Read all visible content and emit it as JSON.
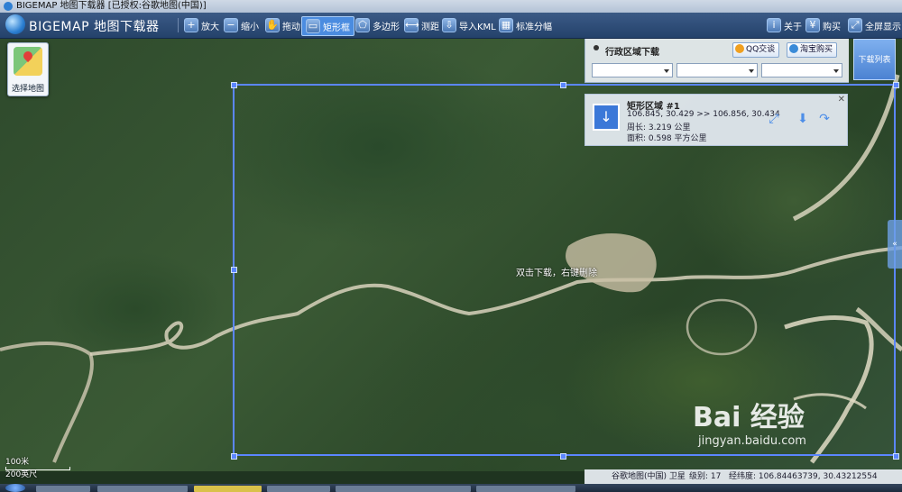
{
  "window": {
    "title": "BIGEMAP 地图下载器 [已授权:谷歌地图(中国)]"
  },
  "toolbar": {
    "brand": "BIGEMAP 地图下载器",
    "tools": [
      {
        "label": "放大",
        "icon": "zoom-in-icon"
      },
      {
        "label": "缩小",
        "icon": "zoom-out-icon"
      },
      {
        "label": "拖动",
        "icon": "hand-icon"
      },
      {
        "label": "矩形框",
        "icon": "rectangle-icon",
        "active": true
      },
      {
        "label": "多边形",
        "icon": "polygon-icon"
      },
      {
        "label": "测距",
        "icon": "ruler-icon"
      },
      {
        "label": "导入KML",
        "icon": "kml-import-icon"
      },
      {
        "label": "标准分幅",
        "icon": "grid-icon"
      }
    ],
    "right": [
      {
        "label": "关于",
        "icon": "info-icon"
      },
      {
        "label": "购买",
        "icon": "cart-icon"
      },
      {
        "label": "全屏显示",
        "icon": "fullscreen-icon"
      }
    ]
  },
  "select_map": {
    "label": "选择地图"
  },
  "admin_panel": {
    "title": "行政区域下载",
    "qq_button": "QQ交谈",
    "taobao_button": "淘宝购买",
    "dropdowns": [
      "",
      "",
      ""
    ]
  },
  "download_list_button": "下载列表",
  "region_card": {
    "title": "矩形区域 #1",
    "coords": "106.845, 30.429 >> 106.856, 30.434",
    "perimeter": "周长: 3.219 公里",
    "area": "面积: 0.598 平方公里"
  },
  "map_hint": "双击下载，右键删除",
  "scale": {
    "top": "100米",
    "bottom": "200英尺"
  },
  "status_bar": {
    "source": "谷歌地图(中国) 卫星",
    "level": "级别:  17",
    "coords": "经纬度:  106.84463739, 30.43212554"
  },
  "watermark": {
    "logo": "Bai 经验",
    "url": "jingyan.baidu.com"
  },
  "colors": {
    "toolbar": "#2b4b78",
    "selection": "#5b86ff",
    "accent": "#3b78d8"
  }
}
